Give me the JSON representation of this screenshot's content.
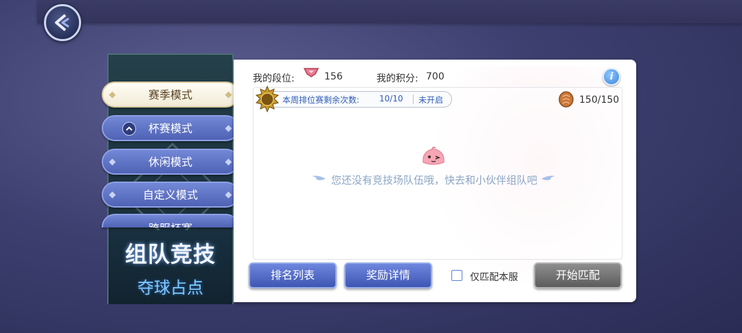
{
  "tabs": [
    {
      "label": "赛季模式",
      "state": "active"
    },
    {
      "label": "杯赛模式",
      "state": "expanded"
    },
    {
      "label": "休闲模式",
      "state": "normal"
    },
    {
      "label": "自定义模式",
      "state": "normal"
    },
    {
      "label": "跨服杯赛",
      "state": "partially-hidden"
    }
  ],
  "mode_panel": {
    "title": "组队竞技",
    "subtitle": "夺球占点"
  },
  "stats": {
    "rank_label": "我的段位:",
    "rank_value": "156",
    "points_label": "我的积分:",
    "points_value": "700"
  },
  "weekly": {
    "label": "本周排位赛剩余次数:",
    "count": "10/10",
    "status": "未开启"
  },
  "currency": {
    "value": "150/150",
    "icon": "coin-icon"
  },
  "empty_message": "您还没有竞技场队伍哦，快去和小伙伴组队吧",
  "buttons": {
    "ranking": "排名列表",
    "rewards": "奖励详情",
    "start": "开始匹配"
  },
  "checkbox": {
    "label": "仅匹配本服",
    "checked": false
  },
  "colors": {
    "accent_blue": "#4f62b5",
    "bg_dark": "#2a2c55",
    "status_blue": "#2f5db8"
  }
}
